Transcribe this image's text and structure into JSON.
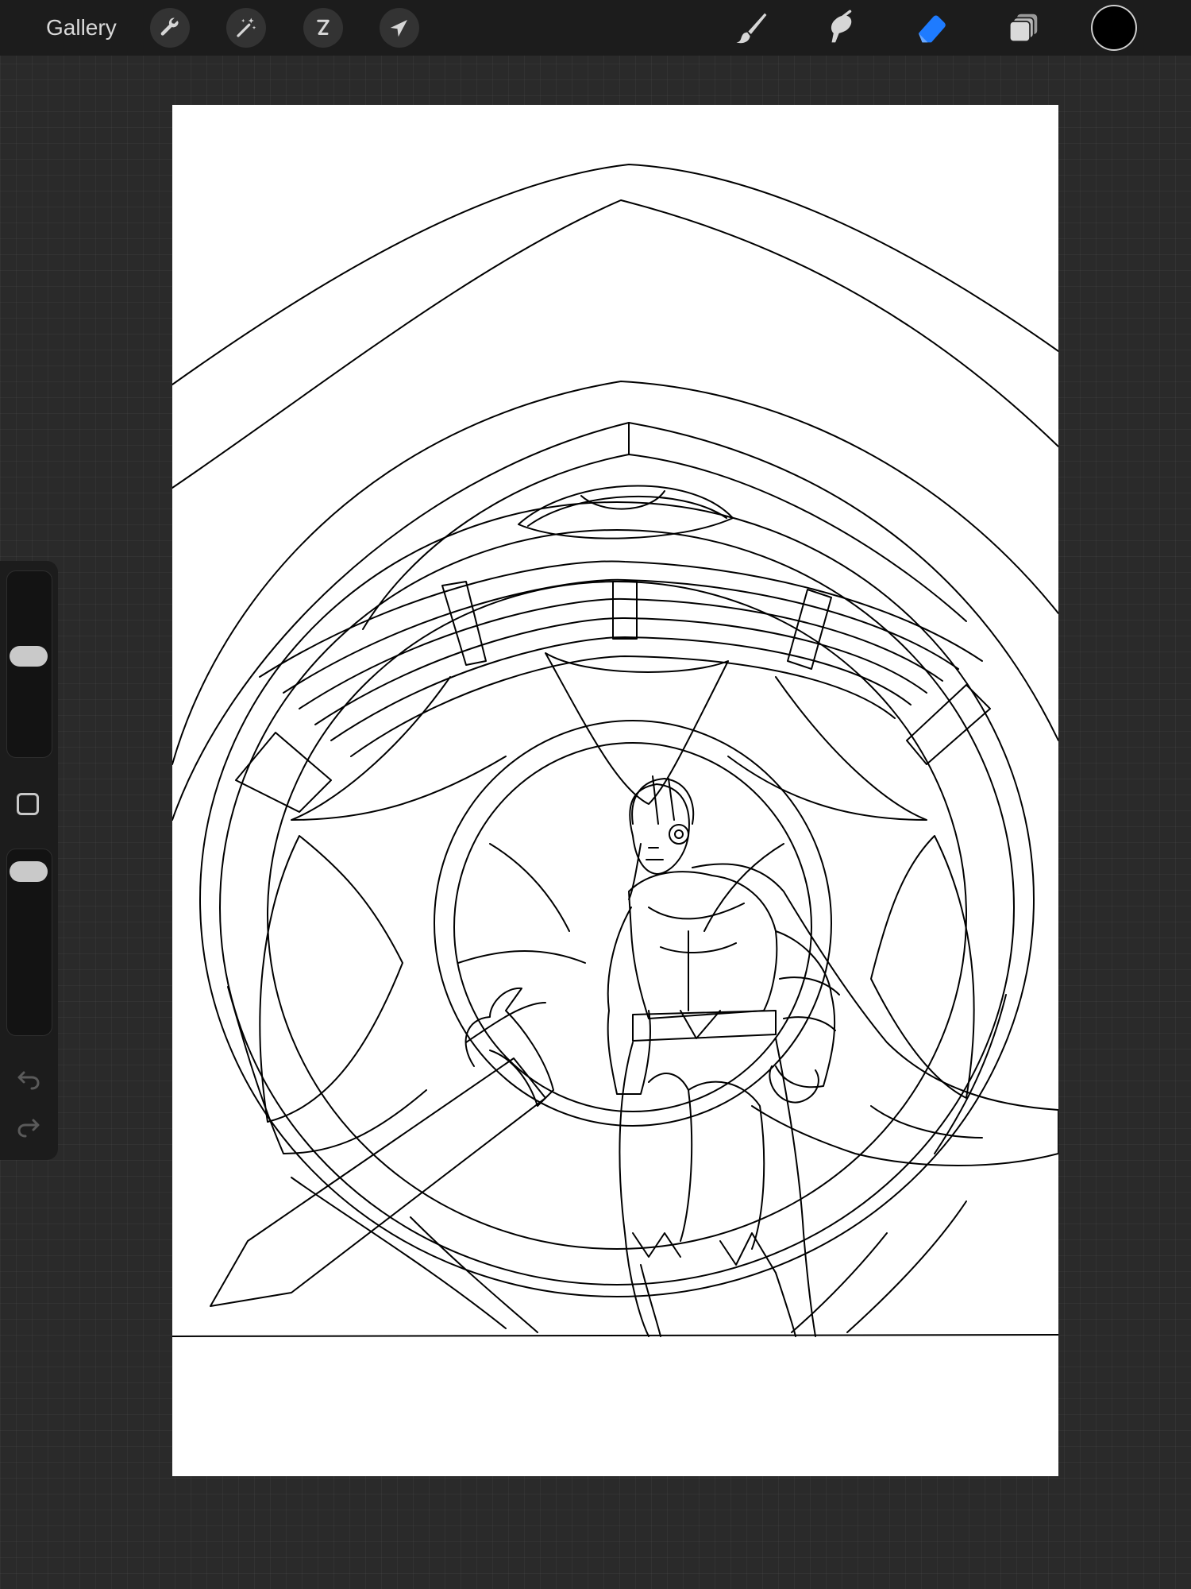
{
  "toolbar": {
    "gallery_label": "Gallery",
    "left_tools": [
      {
        "name": "actions",
        "icon": "wrench-icon"
      },
      {
        "name": "adjustments",
        "icon": "magic-wand-icon"
      },
      {
        "name": "selection",
        "icon": "selection-s-icon"
      },
      {
        "name": "transform",
        "icon": "arrow-cursor-icon"
      }
    ],
    "right_tools": [
      {
        "name": "brush",
        "icon": "brush-icon",
        "active": false
      },
      {
        "name": "smudge",
        "icon": "smudge-finger-icon",
        "active": false
      },
      {
        "name": "eraser",
        "icon": "eraser-icon",
        "active": true
      },
      {
        "name": "layers",
        "icon": "layers-icon",
        "active": false
      }
    ],
    "current_color": "#000000",
    "accent_color": "#1e7bff"
  },
  "sidebar": {
    "brush_size_level": 0.55,
    "opacity_level": 0.94,
    "icons": [
      "modify-square-icon",
      "undo-icon",
      "redo-icon"
    ]
  },
  "canvas": {
    "background": "#ffffff",
    "content": "line-art-illustration"
  }
}
